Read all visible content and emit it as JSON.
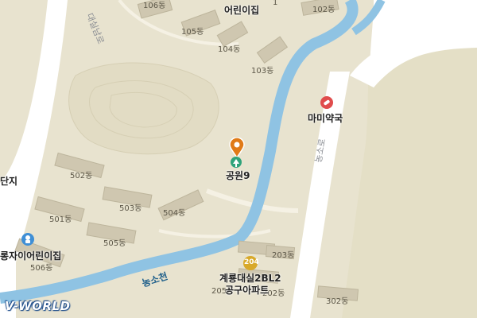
{
  "map": {
    "brand": "V-WORLD",
    "roads": {
      "left_road": "대실남로",
      "right_road": "농소로"
    },
    "stream_name": "농소천",
    "poi": {
      "park": "공원9",
      "pharmacy": "마미약국",
      "daycare_top": "어린이집",
      "daycare_left": "롱자이어린이집",
      "daycare_bottom": "공구아파트",
      "complex_bottom": "계룡대실2BL2",
      "complex_left": "단지"
    },
    "buildings": {
      "b106": "106동",
      "b105": "105동",
      "b104": "104동",
      "b103": "103동",
      "b102": "102동",
      "b502": "502동",
      "b503": "503동",
      "b504": "504동",
      "b501": "501동",
      "b505": "505동",
      "b506": "506동",
      "b203": "203동",
      "b204": "204",
      "b205": "205동",
      "b202": "202동",
      "b302": "302동",
      "b101": "1"
    },
    "colors": {
      "land": "#e8e3cf",
      "road": "#ffffff",
      "water": "#8fc3e3",
      "building": "#cfc7b0",
      "park_pin": "#e07a17",
      "pharmacy": "#e04c4c",
      "daycare": "#3f8fd6"
    }
  }
}
